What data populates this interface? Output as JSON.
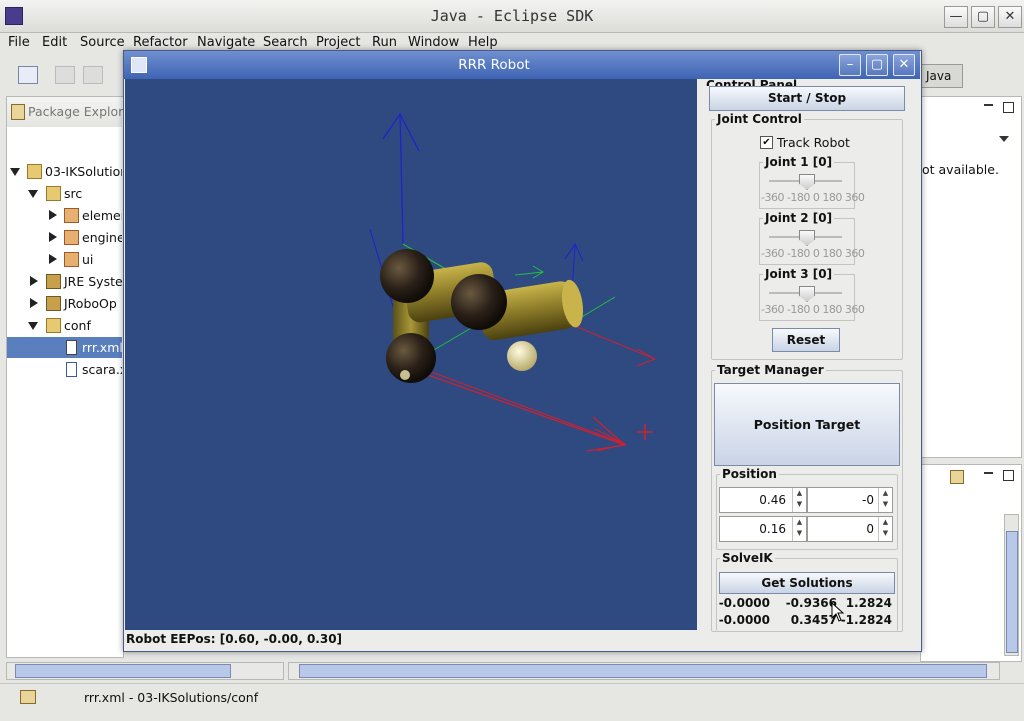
{
  "eclipse": {
    "title": "Java - Eclipse SDK",
    "window_buttons": {
      "minimize": "—",
      "maximize": "▢",
      "close": "✕"
    },
    "menu": [
      "File",
      "Edit",
      "Source",
      "Refactor",
      "Navigate",
      "Search",
      "Project",
      "Run",
      "Window",
      "Help"
    ],
    "perspective_label": "Java",
    "package_explorer": {
      "tab_label": "Package Explore",
      "tree": [
        {
          "label": "03-IKSolution",
          "icon": "project-folder-icon",
          "expanded": true
        },
        {
          "label": "src",
          "icon": "source-folder-icon",
          "expanded": true
        },
        {
          "label": "elemen",
          "icon": "package-icon"
        },
        {
          "label": "engine",
          "icon": "package-icon"
        },
        {
          "label": "ui",
          "icon": "package-icon"
        },
        {
          "label": "JRE Syste",
          "icon": "library-icon"
        },
        {
          "label": "JRoboOp",
          "icon": "library-icon"
        },
        {
          "label": "conf",
          "icon": "folder-icon",
          "expanded": true
        },
        {
          "label": "rrr.xml",
          "icon": "xml-file-icon",
          "selected": true
        },
        {
          "label": "scara.x",
          "icon": "xml-file-icon"
        }
      ]
    },
    "right_panel_text": "ot available.",
    "status_text": "rrr.xml - 03-IKSolutions/conf"
  },
  "robot_window": {
    "title": "RRR Robot",
    "eepos": "Robot EEPos: [0.60, -0.00, 0.30]",
    "control_panel": {
      "title": "Control Panel",
      "start_stop_label": "Start / Stop",
      "joint_control": {
        "title": "Joint Control",
        "track_robot_label": "Track Robot",
        "track_robot_checked": true,
        "joints": [
          {
            "label": "Joint 1 [0]",
            "ticks": "-360  -180  0  180  360"
          },
          {
            "label": "Joint 2 [0]",
            "ticks": "-360  -180  0  180  360"
          },
          {
            "label": "Joint 3 [0]",
            "ticks": "-360  -180  0  180  360"
          }
        ],
        "reset_label": "Reset"
      },
      "target_manager": {
        "title": "Target Manager",
        "position_target_label": "Position Target"
      },
      "position": {
        "title": "Position",
        "values": [
          "0.46",
          "-0",
          "0.16",
          "0"
        ]
      },
      "solve_ik": {
        "title": "SolveIK",
        "get_solutions_label": "Get Solutions",
        "solutions": [
          [
            "-0.0000",
            "-0.9366",
            "1.2824"
          ],
          [
            "-0.0000",
            "0.3457",
            "-1.2824"
          ]
        ]
      }
    }
  },
  "colors": {
    "canvas_bg": "#2e4a80",
    "axis_x": "#d02030",
    "axis_y": "#2020d0",
    "axis_z": "#20c040",
    "link_color": "#8a7a28",
    "joint_color": "#2a2018",
    "title_blue": "#4a6cb8"
  }
}
